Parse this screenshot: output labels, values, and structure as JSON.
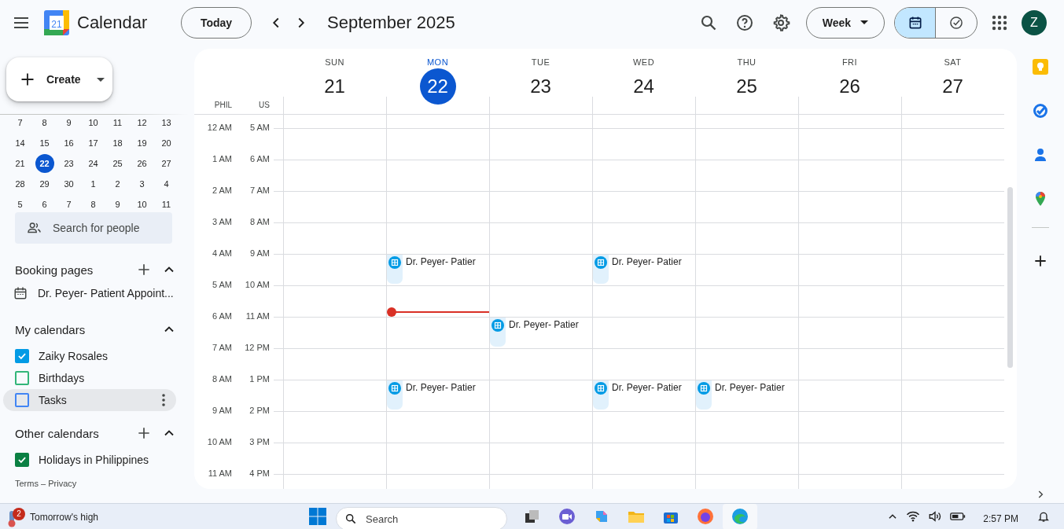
{
  "header": {
    "logo_day": "21",
    "app_title": "Calendar",
    "today_button": "Today",
    "period": "September 2025",
    "view_select": "Week",
    "view_toggle": [
      {
        "kind": "calendar",
        "selected": true
      },
      {
        "kind": "tasks",
        "selected": false
      }
    ],
    "avatar": "Z"
  },
  "sidebar": {
    "create_button": "Create",
    "mini_calendar": [
      [
        {
          "d": "7",
          "selected": false
        },
        {
          "d": "8",
          "selected": false
        },
        {
          "d": "9",
          "selected": false
        },
        {
          "d": "10",
          "selected": false
        },
        {
          "d": "11",
          "selected": false
        },
        {
          "d": "12",
          "selected": false
        },
        {
          "d": "13",
          "selected": false
        }
      ],
      [
        {
          "d": "14",
          "selected": false
        },
        {
          "d": "15",
          "selected": false
        },
        {
          "d": "16",
          "selected": false
        },
        {
          "d": "17",
          "selected": false
        },
        {
          "d": "18",
          "selected": false
        },
        {
          "d": "19",
          "selected": false
        },
        {
          "d": "20",
          "selected": false
        }
      ],
      [
        {
          "d": "21",
          "selected": false
        },
        {
          "d": "22",
          "selected": true
        },
        {
          "d": "23",
          "selected": false
        },
        {
          "d": "24",
          "selected": false
        },
        {
          "d": "25",
          "selected": false
        },
        {
          "d": "26",
          "selected": false
        },
        {
          "d": "27",
          "selected": false
        }
      ],
      [
        {
          "d": "28",
          "selected": false
        },
        {
          "d": "29",
          "selected": false
        },
        {
          "d": "30",
          "selected": false
        },
        {
          "d": "1",
          "selected": false
        },
        {
          "d": "2",
          "selected": false
        },
        {
          "d": "3",
          "selected": false
        },
        {
          "d": "4",
          "selected": false
        }
      ],
      [
        {
          "d": "5",
          "selected": false
        },
        {
          "d": "6",
          "selected": false
        },
        {
          "d": "7",
          "selected": false
        },
        {
          "d": "8",
          "selected": false
        },
        {
          "d": "9",
          "selected": false
        },
        {
          "d": "10",
          "selected": false
        },
        {
          "d": "11",
          "selected": false
        }
      ]
    ],
    "search_people": {
      "placeholder": "Search for people"
    },
    "booking_pages": {
      "title": "Booking pages",
      "items": [
        "Dr. Peyer- Patient Appoint..."
      ]
    },
    "my_calendars": {
      "title": "My calendars",
      "items": [
        {
          "label": "Zaiky Rosales",
          "checked": true,
          "color": "#039be5",
          "hovered": false
        },
        {
          "label": "Birthdays",
          "checked": false,
          "color": "#33b679",
          "hovered": false
        },
        {
          "label": "Tasks",
          "checked": false,
          "color": "#4285f4",
          "hovered": true
        }
      ]
    },
    "other_calendars": {
      "title": "Other calendars",
      "items": [
        {
          "label": "Holidays in Philippines",
          "checked": true,
          "color": "#0b8043",
          "hovered": false
        }
      ]
    },
    "footer": {
      "terms": "Terms",
      "separator": "–",
      "privacy": "Privacy"
    }
  },
  "week": {
    "timezones": [
      "PHIL",
      "US"
    ],
    "days": [
      {
        "name": "SUN",
        "date": "21",
        "selected": false
      },
      {
        "name": "MON",
        "date": "22",
        "selected": true
      },
      {
        "name": "TUE",
        "date": "23",
        "selected": false
      },
      {
        "name": "WED",
        "date": "24",
        "selected": false
      },
      {
        "name": "THU",
        "date": "25",
        "selected": false
      },
      {
        "name": "FRI",
        "date": "26",
        "selected": false
      },
      {
        "name": "SAT",
        "date": "27",
        "selected": false
      }
    ],
    "rows": [
      {
        "phil": "12 AM",
        "us": "5 AM"
      },
      {
        "phil": "1 AM",
        "us": "6 AM"
      },
      {
        "phil": "2 AM",
        "us": "7 AM"
      },
      {
        "phil": "3 AM",
        "us": "8 AM"
      },
      {
        "phil": "4 AM",
        "us": "9 AM",
        "cells": [
          null,
          {
            "event": "Dr. Peyer- Patier"
          },
          null,
          {
            "event": "Dr. Peyer- Patier"
          },
          null,
          null,
          null
        ]
      },
      {
        "phil": "5 AM",
        "us": "10 AM",
        "cells": [
          null,
          {
            "now_line": true
          },
          null,
          null,
          null,
          null,
          null
        ]
      },
      {
        "phil": "6 AM",
        "us": "11 AM",
        "cells": [
          null,
          null,
          {
            "event": "Dr. Peyer- Patier"
          },
          null,
          null,
          null,
          null
        ]
      },
      {
        "phil": "7 AM",
        "us": "12 PM"
      },
      {
        "phil": "8 AM",
        "us": "1 PM",
        "cells": [
          null,
          {
            "event": "Dr. Peyer- Patier"
          },
          null,
          {
            "event": "Dr. Peyer- Patier"
          },
          {
            "event": "Dr. Peyer- Patier"
          },
          null,
          null
        ]
      },
      {
        "phil": "9 AM",
        "us": "2 PM"
      },
      {
        "phil": "10 AM",
        "us": "3 PM"
      },
      {
        "phil": "11 AM",
        "us": "4 PM"
      }
    ]
  },
  "taskbar": {
    "weather_badge": "2",
    "weather_text": "Tomorrow's high",
    "search": {
      "placeholder": "Search"
    },
    "clock": "2:57 PM"
  }
}
